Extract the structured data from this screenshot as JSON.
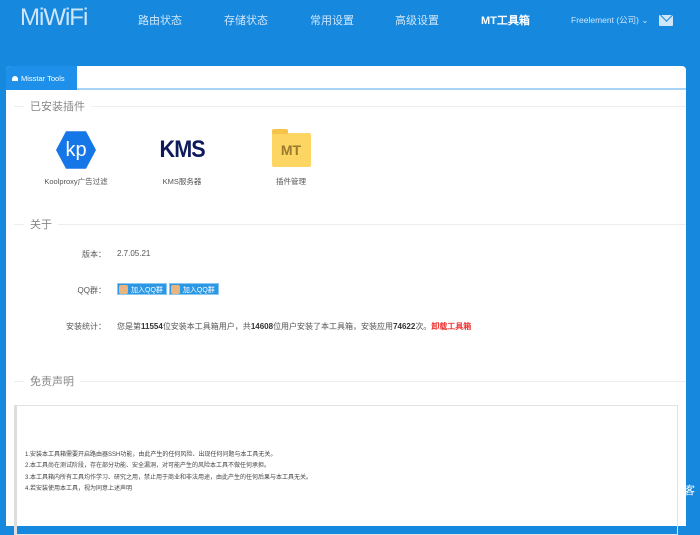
{
  "header": {
    "logo": "MiWiFi",
    "nav": [
      "路由状态",
      "存储状态",
      "常用设置",
      "高级设置",
      "MT工具箱"
    ],
    "user": "Freelement (公司) ⌄"
  },
  "tab": {
    "label": "Misstar Tools"
  },
  "installed": {
    "title": "已安装插件",
    "plugins": [
      {
        "icon_text": "kp",
        "label": "Koolproxy广告过滤"
      },
      {
        "icon_text": "KMS",
        "label": "KMS服务器"
      },
      {
        "icon_text": "MT",
        "label": "插件管理"
      }
    ]
  },
  "about": {
    "title": "关于",
    "version_label": "版本：",
    "version": "2.7.05.21",
    "qq_label": "QQ群：",
    "qq_buttons": [
      "加入QQ群",
      "加入QQ群"
    ],
    "stats_label": "安装统计：",
    "stats": {
      "p1": "您是第",
      "n1": "11554",
      "p2": "位安装本工具箱用户，共",
      "n2": "14608",
      "p3": "位用户安装了本工具箱，安装应用",
      "n3": "74622",
      "p4": "次。",
      "uninstall": "卸载工具箱"
    }
  },
  "disclaimer": {
    "title": "免责声明",
    "lines": [
      "1.安装本工具箱需要开启路由器SSH功能，由此产生的任何风险、出现任何问题与本工具无关。",
      "2.本工具尚在测试阶段，存在部分功能、安全漏洞，对可能产生的风险本工具不做任何承担。",
      "3.本工具箱内所有工具均作学习、研究之用，禁止用于商业和非法用途，由此产生的任何后果与本工具无关。",
      "4.若安装使用本工具，视为同意上述声明"
    ]
  },
  "watermark": "客"
}
